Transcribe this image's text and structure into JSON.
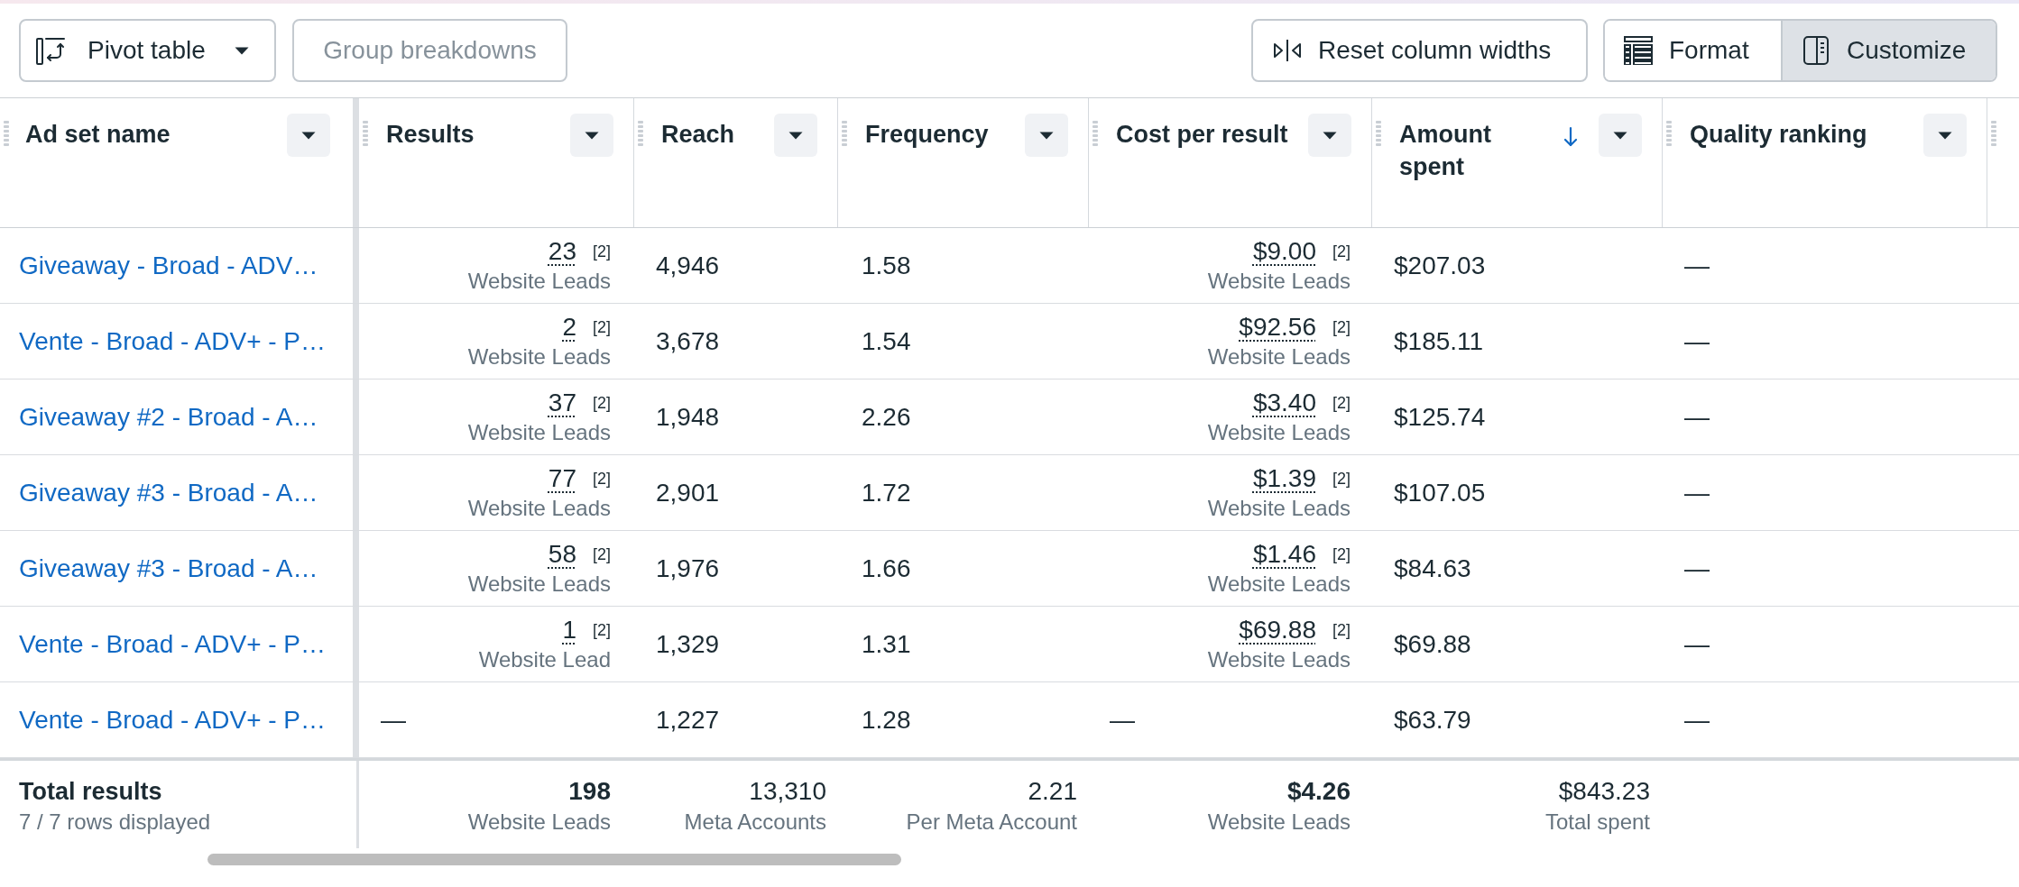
{
  "toolbar": {
    "pivot_table": {
      "label": "Pivot table"
    },
    "group_breakdowns": {
      "label": "Group breakdowns",
      "disabled": true
    },
    "reset_column_widths": {
      "label": "Reset column widths"
    },
    "view_toggle": [
      {
        "label": "Format",
        "selected": false
      },
      {
        "label": "Customize",
        "selected": true
      }
    ]
  },
  "table": {
    "columns": [
      {
        "label": "Ad set name",
        "sorted": false
      },
      {
        "label": "Results",
        "sorted": false
      },
      {
        "label": "Reach",
        "sorted": false
      },
      {
        "label": "Frequency",
        "sorted": false
      },
      {
        "label": "Cost per result",
        "sorted": false
      },
      {
        "label": "Amount spent",
        "sorted": true
      },
      {
        "label": "Quality ranking",
        "sorted": false
      }
    ],
    "rows": [
      {
        "ad_set_name": "Giveaway - Broad - ADV…",
        "results": {
          "kind": "metric",
          "value": "23",
          "note": "[2]",
          "unit": "Website Leads"
        },
        "reach": "4,946",
        "frequency": "1.58",
        "cost_per_result": {
          "kind": "metric",
          "value": "$9.00",
          "note": "[2]",
          "unit": "Website Leads"
        },
        "amount_spent": "$207.03",
        "quality_ranking": "—"
      },
      {
        "ad_set_name": "Vente - Broad - ADV+ - P…",
        "results": {
          "kind": "metric",
          "value": "2",
          "note": "[2]",
          "unit": "Website Leads"
        },
        "reach": "3,678",
        "frequency": "1.54",
        "cost_per_result": {
          "kind": "metric",
          "value": "$92.56",
          "note": "[2]",
          "unit": "Website Leads"
        },
        "amount_spent": "$185.11",
        "quality_ranking": "—"
      },
      {
        "ad_set_name": "Giveaway #2 - Broad - A…",
        "results": {
          "kind": "metric",
          "value": "37",
          "note": "[2]",
          "unit": "Website Leads"
        },
        "reach": "1,948",
        "frequency": "2.26",
        "cost_per_result": {
          "kind": "metric",
          "value": "$3.40",
          "note": "[2]",
          "unit": "Website Leads"
        },
        "amount_spent": "$125.74",
        "quality_ranking": "—"
      },
      {
        "ad_set_name": "Giveaway #3 - Broad - A…",
        "results": {
          "kind": "metric",
          "value": "77",
          "note": "[2]",
          "unit": "Website Leads"
        },
        "reach": "2,901",
        "frequency": "1.72",
        "cost_per_result": {
          "kind": "metric",
          "value": "$1.39",
          "note": "[2]",
          "unit": "Website Leads"
        },
        "amount_spent": "$107.05",
        "quality_ranking": "—"
      },
      {
        "ad_set_name": "Giveaway #3 - Broad - A…",
        "results": {
          "kind": "metric",
          "value": "58",
          "note": "[2]",
          "unit": "Website Leads"
        },
        "reach": "1,976",
        "frequency": "1.66",
        "cost_per_result": {
          "kind": "metric",
          "value": "$1.46",
          "note": "[2]",
          "unit": "Website Leads"
        },
        "amount_spent": "$84.63",
        "quality_ranking": "—"
      },
      {
        "ad_set_name": "Vente - Broad - ADV+ - P…",
        "results": {
          "kind": "metric",
          "value": "1",
          "note": "[2]",
          "unit": "Website Lead"
        },
        "reach": "1,329",
        "frequency": "1.31",
        "cost_per_result": {
          "kind": "metric",
          "value": "$69.88",
          "note": "[2]",
          "unit": "Website Leads"
        },
        "amount_spent": "$69.88",
        "quality_ranking": "—"
      },
      {
        "ad_set_name": "Vente - Broad - ADV+ - P…",
        "results": {
          "kind": "empty",
          "value": "—"
        },
        "reach": "1,227",
        "frequency": "1.28",
        "cost_per_result": {
          "kind": "empty",
          "value": "—"
        },
        "amount_spent": "$63.79",
        "quality_ranking": "—"
      }
    ],
    "totals": {
      "label": "Total results",
      "rows_displayed": "7 / 7 rows displayed",
      "cells": [
        {
          "value": "198",
          "unit": "Website Leads",
          "emphasized": true
        },
        {
          "value": "13,310",
          "unit": "Meta Accounts",
          "emphasized": false
        },
        {
          "value": "2.21",
          "unit": "Per Meta Account",
          "emphasized": false
        },
        {
          "value": "$4.26",
          "unit": "Website Leads",
          "emphasized": true
        },
        {
          "value": "$843.23",
          "unit": "Total spent",
          "emphasized": false
        }
      ]
    }
  }
}
